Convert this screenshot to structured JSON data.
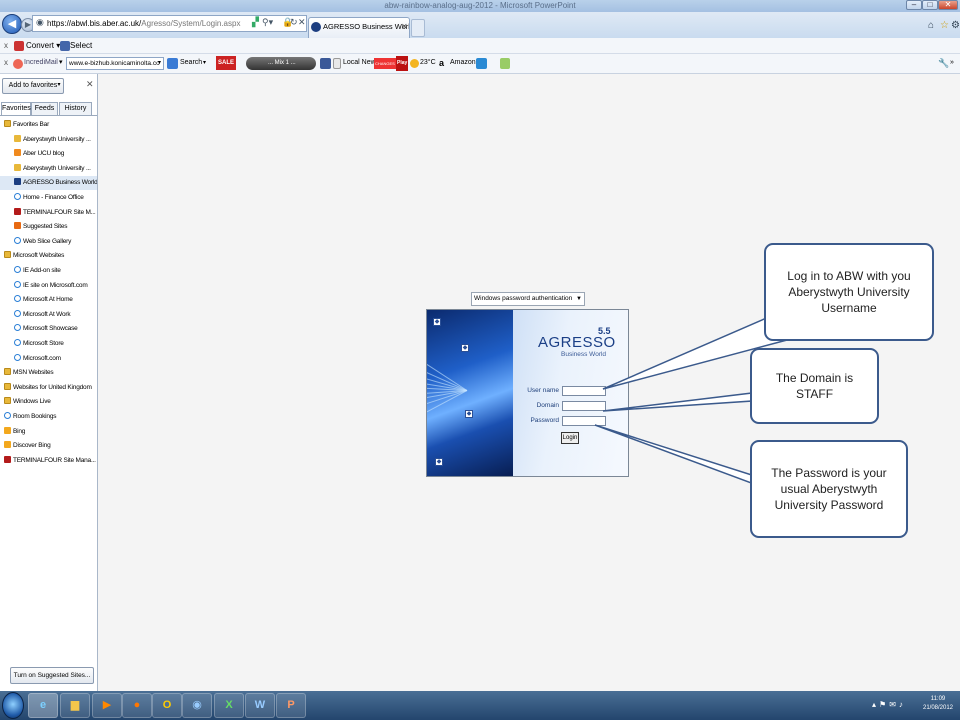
{
  "window": {
    "title": "abw-rainbow-analog-aug-2012 - Microsoft PowerPoint"
  },
  "browser": {
    "address": "https://abwl.bis.aber.ac.uk/Agresso/System/Login.aspx",
    "address_host": "https://abwl.bis.aber.ac.uk/",
    "address_path": "Agresso/System/Login.aspx",
    "tab_title": "AGRESSO Business World",
    "command_bar": {
      "close_x": "x",
      "convert_label": "Convert",
      "select_label": "Select"
    },
    "toolbar": {
      "close_x": "x",
      "mail_label": "IncrediMail",
      "url_field": "www.e-bizhub.konicaminolta.co",
      "search_label": "Search",
      "sale_badge": "SALE",
      "player_label": "... Mix 1 ...",
      "local_news_label": "Local News",
      "changes_badge": "CHANGES",
      "play_badge": "Play",
      "temperature": "23°C",
      "amazon_label": "Amazon"
    }
  },
  "sidebar": {
    "add_favorites": "Add to favorites",
    "tabs": [
      "Favorites",
      "Feeds",
      "History"
    ],
    "items": [
      {
        "label": "Favorites Bar",
        "indent": 0,
        "icon": "folder-icon"
      },
      {
        "label": "Aberystwyth University ...",
        "indent": 1,
        "icon": "aber-icon"
      },
      {
        "label": "Aber UCU blog",
        "indent": 1,
        "icon": "blog-icon"
      },
      {
        "label": "Aberystwyth University ...",
        "indent": 1,
        "icon": "aber-icon"
      },
      {
        "label": "AGRESSO Business World",
        "indent": 1,
        "icon": "agresso-icon"
      },
      {
        "label": "Home - Finance Office",
        "indent": 1,
        "icon": "ie-page-icon"
      },
      {
        "label": "TERMINALFOUR Site M...",
        "indent": 1,
        "icon": "terminalfour-icon"
      },
      {
        "label": "Suggested Sites",
        "indent": 1,
        "icon": "suggested-icon"
      },
      {
        "label": "Web Slice Gallery",
        "indent": 1,
        "icon": "ie-page-icon"
      },
      {
        "label": "Microsoft Websites",
        "indent": 0,
        "icon": "folder-icon"
      },
      {
        "label": "IE Add-on site",
        "indent": 1,
        "icon": "ie-page-icon"
      },
      {
        "label": "IE site on Microsoft.com",
        "indent": 1,
        "icon": "ie-page-icon"
      },
      {
        "label": "Microsoft At Home",
        "indent": 1,
        "icon": "ie-page-icon"
      },
      {
        "label": "Microsoft At Work",
        "indent": 1,
        "icon": "ie-page-icon"
      },
      {
        "label": "Microsoft Showcase",
        "indent": 1,
        "icon": "ie-page-icon"
      },
      {
        "label": "Microsoft Store",
        "indent": 1,
        "icon": "ie-page-icon"
      },
      {
        "label": "Microsoft.com",
        "indent": 1,
        "icon": "ie-page-icon"
      },
      {
        "label": "MSN Websites",
        "indent": 0,
        "icon": "folder-icon"
      },
      {
        "label": "Websites for United Kingdom",
        "indent": 0,
        "icon": "folder-icon"
      },
      {
        "label": "Windows Live",
        "indent": 0,
        "icon": "folder-icon"
      },
      {
        "label": "Room Bookings",
        "indent": 0,
        "icon": "ie-page-icon"
      },
      {
        "label": "Bing",
        "indent": 0,
        "icon": "bing-icon"
      },
      {
        "label": "Discover Bing",
        "indent": 0,
        "icon": "bing-icon"
      },
      {
        "label": "TERMINALFOUR Site Mana...",
        "indent": 0,
        "icon": "terminalfour-icon"
      }
    ],
    "selected_index": 4,
    "suggested_button": "Turn on Suggested Sites..."
  },
  "login": {
    "auth_select": "Windows password authentication",
    "logo": "AGRESSO",
    "version": "5.5",
    "subtitle": "Business World",
    "username_label": "User name",
    "domain_label": "Domain",
    "password_label": "Password",
    "username_value": "",
    "domain_value": "",
    "password_value": "",
    "login_button": "Login"
  },
  "callouts": {
    "username": "Log in to ABW with you Aberystwyth University Username",
    "domain": "The Domain is STAFF",
    "password": "The Password is your usual Aberystwyth University Password"
  },
  "taskbar": {
    "time": "11:09",
    "date": "21/08/2012"
  },
  "colors": {
    "callout_border": "#3b5a8c",
    "page_background": "#f4f4f4",
    "taskbar": "#23456d"
  }
}
